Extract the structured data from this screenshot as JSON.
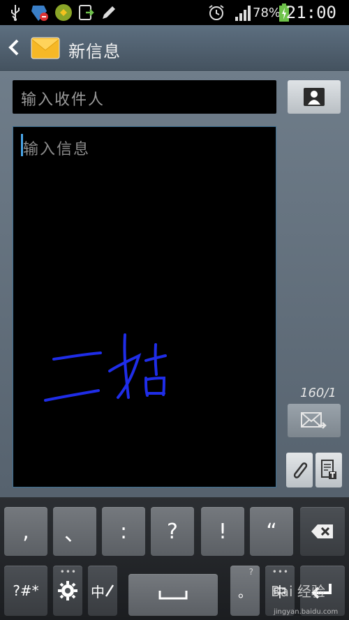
{
  "status_bar": {
    "battery_percent": "78%",
    "time": "21:00"
  },
  "header": {
    "title": "新信息"
  },
  "compose": {
    "recipient_placeholder": "输入收件人",
    "message_placeholder": "输入信息",
    "handwriting_text": "二姑",
    "counter": "160/1"
  },
  "keyboard": {
    "row1": [
      ",",
      "、",
      ":",
      "?",
      "!",
      "“"
    ],
    "symbols_key": "?#*",
    "lang_key": "中",
    "period_key": "。",
    "period_hint": "?",
    "ch_key": "中"
  },
  "watermark": {
    "brand": "Bai 经验",
    "url": "jingyan.baidu.com"
  },
  "colors": {
    "handwriting": "#1f2de8",
    "accent": "#4aa6e8"
  }
}
